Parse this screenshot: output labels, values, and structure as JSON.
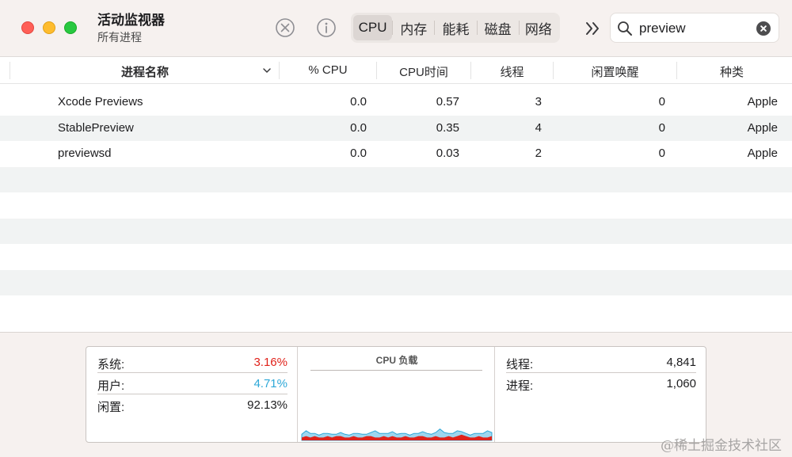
{
  "window": {
    "title": "活动监视器",
    "subtitle": "所有进程"
  },
  "toolbar": {
    "tabs": [
      {
        "label": "CPU",
        "active": true
      },
      {
        "label": "内存",
        "active": false
      },
      {
        "label": "能耗",
        "active": false
      },
      {
        "label": "磁盘",
        "active": false
      },
      {
        "label": "网络",
        "active": false
      }
    ],
    "search_value": "preview",
    "icons": [
      "stop-process-icon",
      "info-icon",
      "overflow-chevron-icon",
      "search-icon",
      "clear-search-icon"
    ]
  },
  "table": {
    "columns": [
      "进程名称",
      "% CPU",
      "CPU时间",
      "线程",
      "闲置唤醒",
      "种类"
    ],
    "rows": [
      {
        "name": "Xcode Previews",
        "cpu": "0.0",
        "cpu_time": "0.57",
        "threads": "3",
        "idle_wakeups": "0",
        "kind": "Apple"
      },
      {
        "name": "StablePreview",
        "cpu": "0.0",
        "cpu_time": "0.35",
        "threads": "4",
        "idle_wakeups": "0",
        "kind": "Apple"
      },
      {
        "name": "previewsd",
        "cpu": "0.0",
        "cpu_time": "0.03",
        "threads": "2",
        "idle_wakeups": "0",
        "kind": "Apple"
      }
    ]
  },
  "summary": {
    "system_label": "系统:",
    "system_value": "3.16%",
    "system_color": "#e0221a",
    "user_label": "用户:",
    "user_value": "4.71%",
    "user_color": "#2ea8d8",
    "idle_label": "闲置:",
    "idle_value": "92.13%",
    "chart_title": "CPU 负载",
    "threads_label": "线程:",
    "threads_value": "4,841",
    "processes_label": "进程:",
    "processes_value": "1,060"
  },
  "cpu_load_history": {
    "system": [
      2,
      3,
      2,
      3,
      2,
      2,
      3,
      2,
      3,
      3,
      2,
      2,
      3,
      2,
      2,
      3,
      3,
      2,
      2,
      3,
      2,
      3,
      2,
      2,
      3,
      2,
      2,
      3,
      3,
      2,
      2,
      3,
      2,
      2,
      3,
      2,
      3,
      4,
      3,
      2,
      2,
      3,
      2,
      2,
      3
    ],
    "user": [
      5,
      8,
      6,
      5,
      4,
      6,
      5,
      5,
      4,
      6,
      5,
      4,
      5,
      6,
      5,
      4,
      6,
      9,
      6,
      5,
      6,
      7,
      5,
      6,
      5,
      4,
      6,
      5,
      7,
      6,
      5,
      6,
      11,
      7,
      5,
      6,
      8,
      6,
      5,
      4,
      6,
      5,
      6,
      9,
      6
    ]
  },
  "watermark": "@稀土掘金技术社区"
}
